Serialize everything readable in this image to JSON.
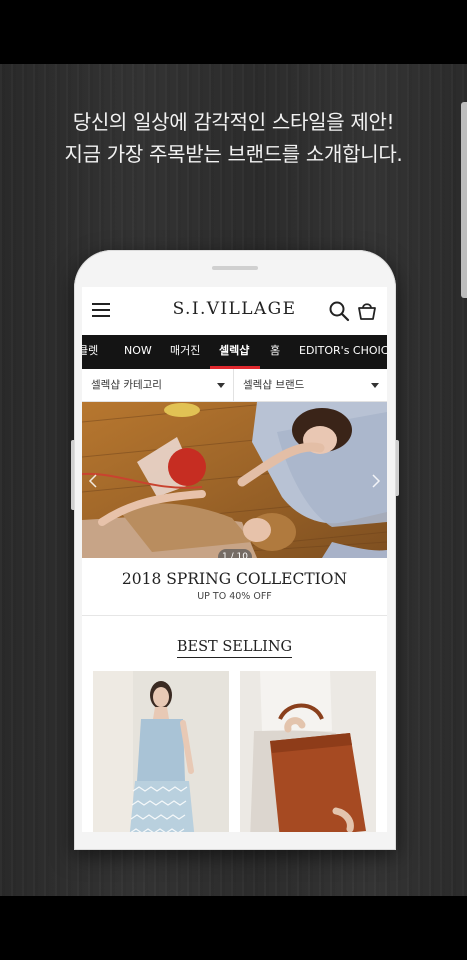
{
  "promo": {
    "headline_line1": "당신의 일상에 감각적인 스타일을 제안!",
    "headline_line2": "지금 가장 주목받는 브랜드를 소개합니다."
  },
  "app": {
    "logo": "S.I.VILLAGE",
    "nav_items": [
      "클렛",
      "NOW",
      "매거진",
      "셀렉샵",
      "홈",
      "EDITOR's CHOIC"
    ],
    "active_nav": "셀렉샵",
    "filters": [
      "셀렉샵 카테고리",
      "셀렉샵 브랜드"
    ],
    "banner": {
      "pager": "1 / 10",
      "title": "2018 SPRING COLLECTION",
      "subtitle": "UP TO 40% OFF"
    },
    "section_title": "BEST SELLING"
  },
  "icons": [
    "menu-icon",
    "search-icon",
    "shopping-bag-icon",
    "chevron-left-icon",
    "chevron-right-icon",
    "caret-down-icon"
  ],
  "colors": {
    "nav_bg": "#141414",
    "nav_active_underline": "#e0282e",
    "backdrop": "#2e2e2e"
  }
}
